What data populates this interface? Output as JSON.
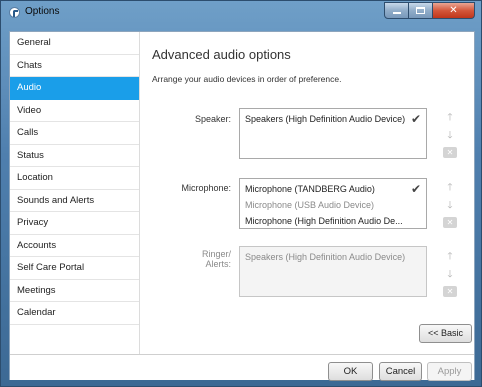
{
  "window": {
    "title": "Options"
  },
  "sidebar": {
    "items": [
      {
        "label": "General",
        "active": false
      },
      {
        "label": "Chats",
        "active": false
      },
      {
        "label": "Audio",
        "active": true
      },
      {
        "label": "Video",
        "active": false
      },
      {
        "label": "Calls",
        "active": false
      },
      {
        "label": "Status",
        "active": false
      },
      {
        "label": "Location",
        "active": false
      },
      {
        "label": "Sounds and Alerts",
        "active": false
      },
      {
        "label": "Privacy",
        "active": false
      },
      {
        "label": "Accounts",
        "active": false
      },
      {
        "label": "Self Care Portal",
        "active": false
      },
      {
        "label": "Meetings",
        "active": false
      },
      {
        "label": "Calendar",
        "active": false
      }
    ]
  },
  "main": {
    "heading": "Advanced audio options",
    "subtitle": "Arrange your audio devices in order of preference.",
    "speaker": {
      "label": "Speaker:",
      "devices": [
        {
          "name": "Speakers (High Definition Audio Device)",
          "selected": true
        }
      ]
    },
    "microphone": {
      "label": "Microphone:",
      "devices": [
        {
          "name": "Microphone (TANDBERG Audio)",
          "selected": true
        },
        {
          "name": "Microphone (USB Audio Device)",
          "selected": false
        },
        {
          "name": "Microphone (High Definition Audio De...",
          "selected": false
        }
      ]
    },
    "ringer": {
      "label": "Ringer/",
      "label_line2": "Alerts:",
      "devices": [
        {
          "name": "Speakers (High Definition Audio Device)",
          "selected": false
        }
      ]
    },
    "basic_button": "<< Basic"
  },
  "footer": {
    "ok": "OK",
    "cancel": "Cancel",
    "apply": "Apply"
  },
  "colors": {
    "accent": "#1a9ee9",
    "title_bar": "#4f7fae",
    "close_button": "#d4573b"
  },
  "icons": {
    "up": "arrow-up-icon",
    "down": "arrow-down-icon",
    "delete": "backspace-icon",
    "check": "checkmark-icon"
  }
}
